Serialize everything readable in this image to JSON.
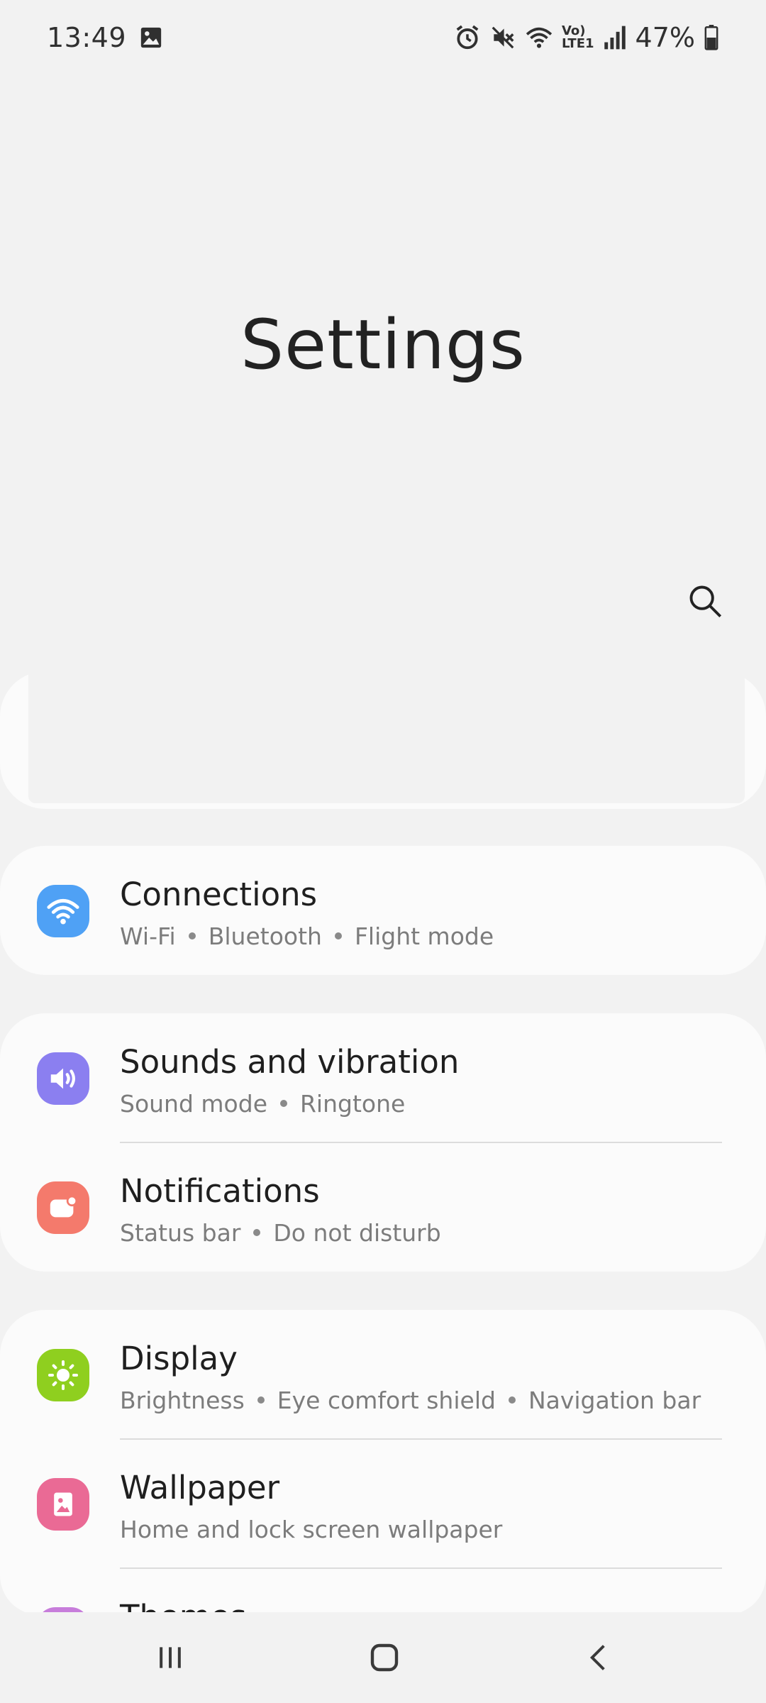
{
  "status_bar": {
    "time": "13:49",
    "battery_percent": "47%",
    "icons": [
      "gallery-icon",
      "alarm-icon",
      "mute-icon",
      "wifi-icon",
      "volte-icon",
      "signal-icon",
      "battery-icon"
    ],
    "volte_text_top": "Vo)",
    "volte_text_bottom": "LTE1"
  },
  "header": {
    "title": "Settings"
  },
  "colors": {
    "background": "#f2f2f2",
    "card": "#fbfbfb",
    "connections": "#4fa1f5",
    "sounds": "#8b7ff0",
    "notifications": "#f47a6c",
    "display": "#8fcf1f",
    "wallpaper": "#ea6a95",
    "themes": "#c77ddb"
  },
  "settings": {
    "connections": {
      "title": "Connections",
      "sub": [
        "Wi-Fi",
        "Bluetooth",
        "Flight mode"
      ]
    },
    "sounds": {
      "title": "Sounds and vibration",
      "sub": [
        "Sound mode",
        "Ringtone"
      ]
    },
    "notifications": {
      "title": "Notifications",
      "sub": [
        "Status bar",
        "Do not disturb"
      ]
    },
    "display": {
      "title": "Display",
      "sub": [
        "Brightness",
        "Eye comfort shield",
        "Navigation bar"
      ]
    },
    "wallpaper": {
      "title": "Wallpaper",
      "sub": [
        "Home and lock screen wallpaper"
      ]
    },
    "themes": {
      "title": "Themes"
    }
  }
}
